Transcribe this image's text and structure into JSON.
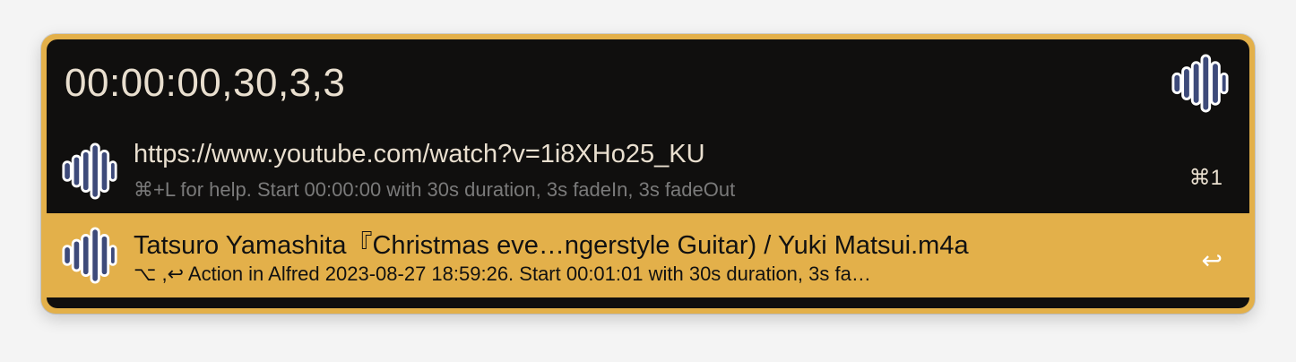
{
  "search": {
    "query": "00:00:00,30,3,3",
    "icon": "audio-waveform-icon"
  },
  "results": [
    {
      "title": "https://www.youtube.com/watch?v=1i8XHo25_KU",
      "subtitle": "⌘+L for help. Start 00:00:00 with 30s duration, 3s fadeIn, 3s fadeOut",
      "shortcut": "⌘1",
      "icon": "audio-waveform-icon"
    },
    {
      "title": "Tatsuro Yamashita『Christmas eve…ngerstyle Guitar) / Yuki Matsui.m4a",
      "subtitle": "⌥ ,↩ Action in Alfred 2023-08-27 18:59:26. Start 00:01:01 with 30s duration, 3s fa…",
      "shortcut": "↩",
      "icon": "audio-waveform-icon"
    }
  ],
  "colors": {
    "accent": "#e3b04a",
    "background": "#100f0e",
    "text": "#e9dfcf",
    "icon": "#3d4a7a"
  }
}
